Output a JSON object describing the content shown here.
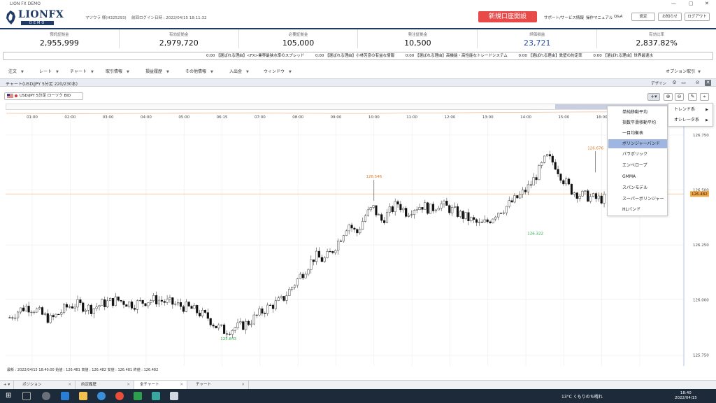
{
  "window": {
    "title": "LION FX DEMO"
  },
  "header": {
    "brand": "LIONFX",
    "brand_sub": "DEMO",
    "user": "マツウラ 様(H325293)",
    "last_login": "前回ログイン日時 : 2022/04/15 18:11:32",
    "open_account": "新規口座開設",
    "links": [
      "サポート/サービス情報",
      "操作マニュアル",
      "Q&A"
    ],
    "buttons": [
      "設定",
      "お知らせ",
      "ログアウト"
    ]
  },
  "summary": [
    {
      "label": "預託証拠金",
      "value": "2,955,999"
    },
    {
      "label": "有効証拠金",
      "value": "2,979,720"
    },
    {
      "label": "必要証拠金",
      "value": "105,000"
    },
    {
      "label": "発注証拠金",
      "value": "10,500"
    },
    {
      "label": "評価損益",
      "value": "23,721"
    },
    {
      "label": "有効比率",
      "value": "2,837.82%"
    }
  ],
  "ticker": [
    "0:00 【選ばれる理由】<FX>業界最狭水準のスプレッド",
    "0:00 【選ばれる理由】小林芳彦の有益な情報",
    "0:00 【選ばれる理由】高機能・高性能なトレードシステム",
    "0:00 【選ばれる理由】鉄壁の約定率",
    "0:00 【選ばれる理由】世界最速水"
  ],
  "menu": [
    "注文",
    "レート",
    "チャート",
    "取引情報",
    "損益履歴",
    "その他情報",
    "入出金",
    "ウィンドウ"
  ],
  "menu_right": "オプション取引",
  "panel": {
    "title": "チャート(USD/JPY 5分足 220/230本)",
    "design": "デザイン"
  },
  "symbol_select": "USD/JPY 5分足 ローソク BID",
  "indicator_menu": {
    "items": [
      "単純移動平均",
      "指数平滑移動平均",
      "一目均衡表",
      "ボリンジャーバンド",
      "パラボリック",
      "エンベロープ",
      "GMMA",
      "スパンモデル",
      "スーパーボリンジャー",
      "HLバンド"
    ],
    "selected": "ボリンジャーバンド"
  },
  "category_menu": [
    "トレンド系",
    "オシレータ系"
  ],
  "chart_data": {
    "type": "candlestick",
    "symbol": "USD/JPY",
    "timeframe": "5分足",
    "x_ticks": [
      "01:00",
      "02:00",
      "03:00",
      "04:00",
      "05:00",
      "06:15",
      "07:00",
      "08:00",
      "09:00",
      "10:00",
      "11:00",
      "12:00",
      "13:00",
      "14:00",
      "15:00",
      "16:00",
      "17:00"
    ],
    "y_ticks": [
      "126.750",
      "126.500",
      "126.250",
      "126.000",
      "125.750"
    ],
    "ylim": [
      125.7,
      126.82
    ],
    "current_price": "126.482",
    "annotations": [
      {
        "text": "126.546",
        "x": "10:00",
        "y": 126.546,
        "type": "high"
      },
      {
        "text": "126.676",
        "x": "15:50",
        "y": 126.676,
        "type": "high"
      },
      {
        "text": "126.322",
        "x": "14:15",
        "y": 126.322,
        "type": "low"
      },
      {
        "text": "125.843",
        "x": "06:10",
        "y": 125.843,
        "type": "low"
      }
    ],
    "close_path": [
      125.92,
      125.95,
      125.97,
      125.96,
      125.93,
      125.91,
      125.94,
      125.97,
      125.98,
      125.97,
      125.96,
      125.98,
      125.99,
      126.0,
      125.99,
      125.98,
      125.99,
      126.0,
      126.0,
      125.99,
      125.98,
      125.97,
      125.96,
      125.94,
      125.92,
      125.88,
      125.86,
      125.87,
      125.88,
      125.9,
      125.93,
      125.96,
      125.98,
      126.0,
      126.05,
      126.1,
      126.15,
      126.2,
      126.18,
      126.22,
      126.28,
      126.35,
      126.3,
      126.38,
      126.42,
      126.36,
      126.4,
      126.44,
      126.4,
      126.42,
      126.43,
      126.41,
      126.44,
      126.42,
      126.4,
      126.38,
      126.36,
      126.34,
      126.36,
      126.4,
      126.42,
      126.45,
      126.48,
      126.52,
      126.58,
      126.65,
      126.62,
      126.55,
      126.5,
      126.48,
      126.47,
      126.46,
      126.46
    ]
  },
  "status_line": "最新 : 2022/04/15 18:40:00 始値 : 126.481 高値 : 126.482 安値 : 126.481 終値 : 126.482",
  "bottom_tabs": [
    "ポジション",
    "約定履歴",
    "全チャート",
    "チャート"
  ],
  "taskbar": {
    "weather": "13°C くもりのち晴れ",
    "time": "18:40",
    "date": "2022/04/15"
  }
}
